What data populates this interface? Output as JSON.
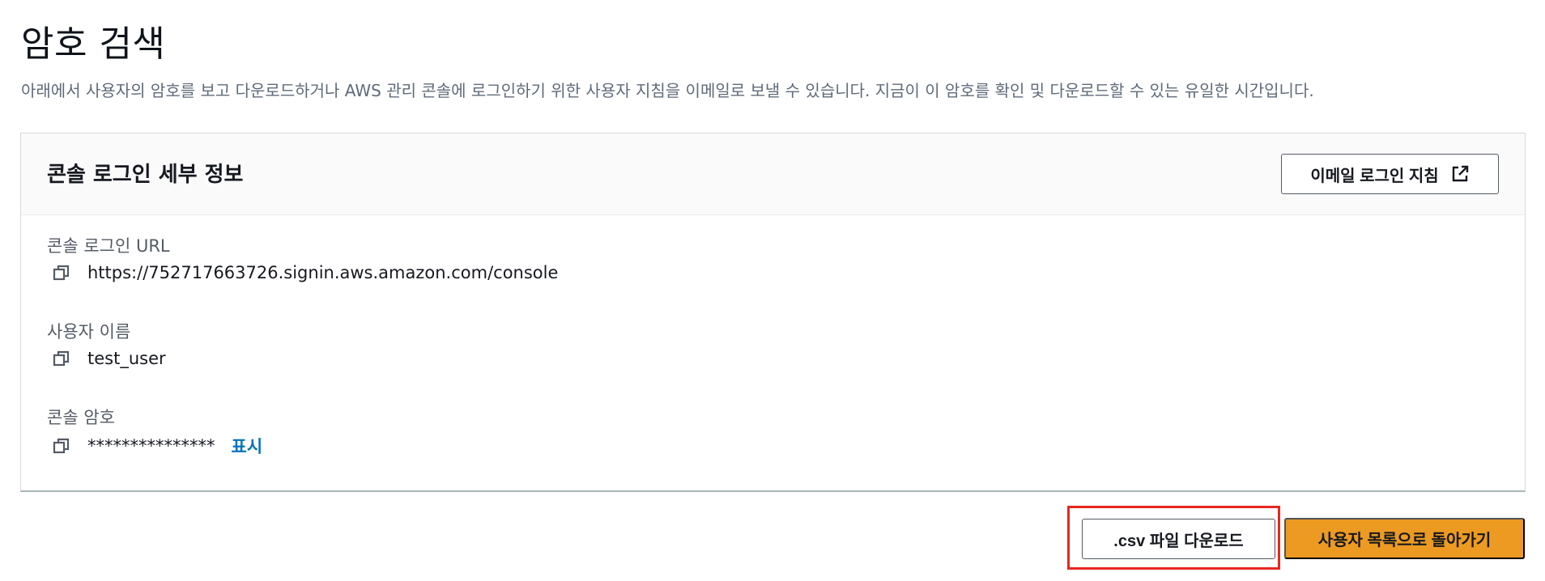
{
  "page": {
    "title": "암호 검색",
    "description": "아래에서 사용자의 암호를 보고 다운로드하거나 AWS 관리 콘솔에 로그인하기 위한 사용자 지침을 이메일로 보낼 수 있습니다. 지금이 이 암호를 확인 및 다운로드할 수 있는 유일한 시간입니다."
  },
  "panel": {
    "title": "콘솔 로그인 세부 정보",
    "email_button_label": "이메일 로그인 지침",
    "email_button_icon": "external-link-icon",
    "fields": [
      {
        "label": "콘솔 로그인 URL",
        "value": "https://752717663726.signin.aws.amazon.com/console"
      },
      {
        "label": "사용자 이름",
        "value": "test_user"
      },
      {
        "label": "콘솔 암호",
        "value": "***************",
        "action": "표시"
      }
    ]
  },
  "footer": {
    "download_csv_label": ".csv 파일 다운로드",
    "back_label": "사용자 목록으로 돌아가기"
  },
  "colors": {
    "primary_button": "#ec9a22",
    "link": "#0073bb",
    "highlight_box": "#e8271f"
  }
}
